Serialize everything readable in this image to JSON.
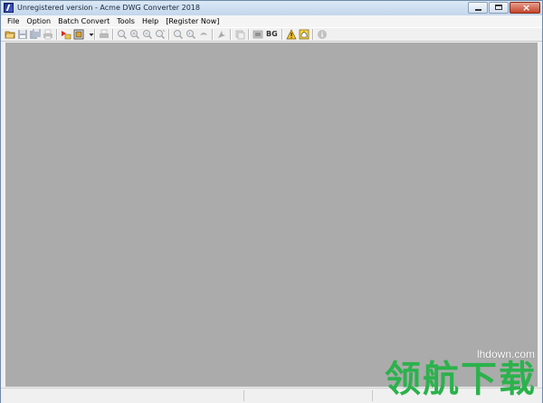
{
  "window": {
    "title": "Unregistered version - Acme DWG Converter 2018"
  },
  "menu": {
    "items": [
      "File",
      "Option",
      "Batch Convert",
      "Tools",
      "Help",
      "[Register Now]"
    ]
  },
  "toolbar": {
    "bg_label": "BG",
    "icons": [
      "open-folder-icon",
      "save-icon",
      "save-all-icon",
      "print-setup-icon",
      "convert-icon",
      "layers-icon",
      "dropdown-arrow-icon",
      "print-icon",
      "zoom-in-icon",
      "zoom-window-icon",
      "zoom-out-icon",
      "zoom-extents-icon",
      "zoom-realtime-icon",
      "zoom-previous-icon",
      "pan-icon",
      "redraw-icon",
      "layer-icon",
      "bg-color-toggle",
      "warning-icon",
      "home-icon",
      "info-icon"
    ]
  },
  "watermark": {
    "url": "lhdown.com",
    "text": "领航下载"
  },
  "colors": {
    "canvas_bg": "#ababab",
    "titlebar_bg": "#c9daef",
    "watermark_green": "#2bb24c"
  }
}
